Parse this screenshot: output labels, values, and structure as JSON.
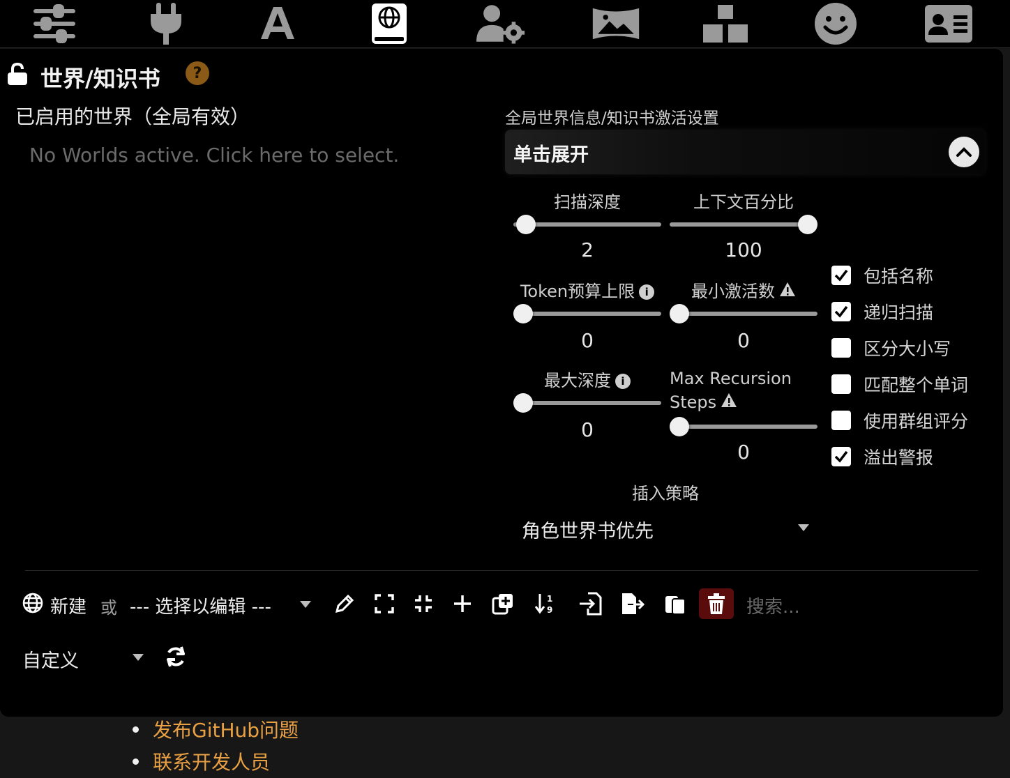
{
  "top_nav": {
    "icons": [
      "sliders-icon",
      "plug-icon",
      "font-icon",
      "book-globe-icon",
      "user-gear-icon",
      "image-icon",
      "cubes-icon",
      "smiley-icon",
      "id-card-icon"
    ],
    "active_index": 3
  },
  "panel": {
    "title": "世界/知识书",
    "help": "?",
    "active_worlds_label": "已启用的世界（全局有效）",
    "active_worlds_placeholder": "No Worlds active. Click here to select."
  },
  "settings": {
    "label": "全局世界信息/知识书激活设置",
    "drawer_label": "单击展开",
    "sliders": {
      "scan_depth": {
        "label": "扫描深度",
        "value": "2",
        "fraction": 0.0
      },
      "context_percent": {
        "label": "上下文百分比",
        "value": "100",
        "fraction": 1.0
      },
      "token_budget": {
        "label": "Token预算上限",
        "value": "0",
        "fraction": 0.0
      },
      "min_activations": {
        "label": "最小激活数",
        "value": "0",
        "fraction": 0.0
      },
      "max_depth": {
        "label": "最大深度",
        "value": "0",
        "fraction": 0.0
      },
      "max_recursion": {
        "label_line1": "Max Recursion",
        "label_line2": "Steps",
        "value": "0",
        "fraction": 0.0
      }
    },
    "checkboxes": [
      {
        "label": "包括名称",
        "checked": true
      },
      {
        "label": "递归扫描",
        "checked": true
      },
      {
        "label": "区分大小写",
        "checked": false
      },
      {
        "label": "匹配整个单词",
        "checked": false
      },
      {
        "label": "使用群组评分",
        "checked": false
      },
      {
        "label": "溢出警报",
        "checked": true
      }
    ],
    "insertion_strategy_label": "插入策略",
    "insertion_strategy_value": "角色世界书优先"
  },
  "toolbar": {
    "new_label": "新建",
    "or_label": "或",
    "select_value": "--- 选择以编辑 ---",
    "search_placeholder": "搜索...",
    "sort_value": "自定义"
  },
  "links": [
    "发布GitHub问题",
    "联系开发人员"
  ],
  "colors": {
    "accent_link": "#e8a043",
    "help_badge": "#8a5a16",
    "delete_bg": "#5a0c0c"
  }
}
